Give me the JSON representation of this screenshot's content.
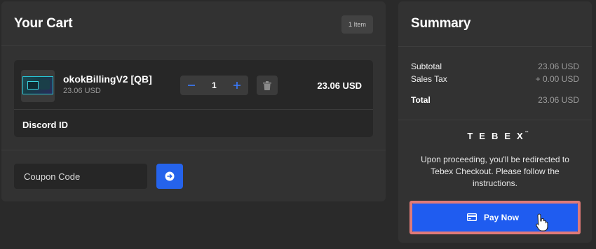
{
  "cart": {
    "title": "Your Cart",
    "item_count": "1 Item",
    "items": [
      {
        "name": "okokBillingV2 [QB]",
        "unit_price": "23.06 USD",
        "quantity": "1",
        "total": "23.06 USD"
      }
    ],
    "discord_label": "Discord ID",
    "coupon": {
      "placeholder": "Coupon Code"
    }
  },
  "summary": {
    "title": "Summary",
    "subtotal_label": "Subtotal",
    "subtotal_value": "23.06 USD",
    "tax_label": "Sales Tax",
    "tax_value": "+ 0.00 USD",
    "total_label": "Total",
    "total_value": "23.06 USD",
    "brand": "TEBEX",
    "brand_mark": "™",
    "info": "Upon proceeding, you'll be redirected to Tebex Checkout. Please follow the instructions.",
    "pay_label": "Pay Now"
  },
  "icons": {
    "minus": "minus-icon",
    "plus": "plus-icon",
    "delete": "trash-icon",
    "apply": "arrow-circle-icon",
    "card": "credit-card-icon",
    "cursor": "pointer-cursor-icon"
  },
  "colors": {
    "accent": "#1f5cf0",
    "highlight": "#e07a78",
    "background": "#2a2a2a",
    "panel": "#323232"
  }
}
